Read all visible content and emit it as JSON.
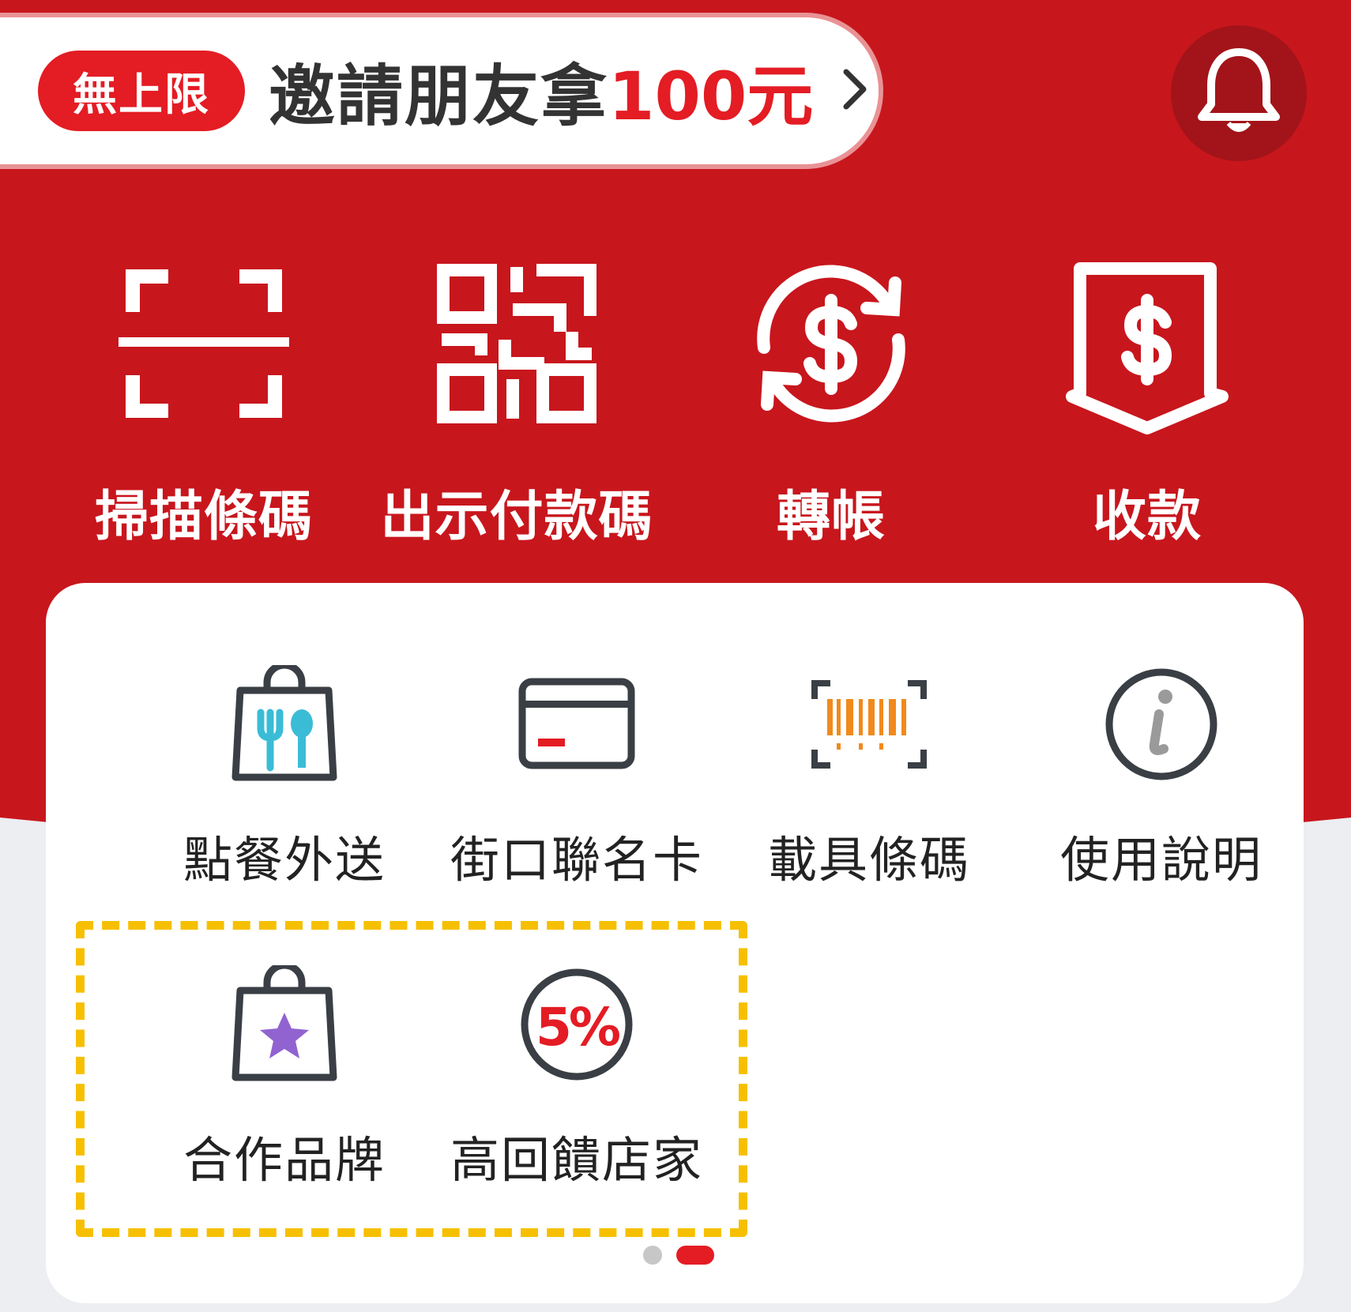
{
  "invite": {
    "badge": "無上限",
    "text": "邀請朋友拿",
    "amount": "100元"
  },
  "actions": [
    {
      "label": "掃描條碼",
      "icon": "scan-frame-icon"
    },
    {
      "label": "出示付款碼",
      "icon": "qr-code-icon"
    },
    {
      "label": "轉帳",
      "icon": "dollar-cycle-icon"
    },
    {
      "label": "收款",
      "icon": "dollar-pocket-icon"
    }
  ],
  "services": [
    {
      "label": "點餐外送",
      "icon": "food-bag-icon"
    },
    {
      "label": "街口聯名卡",
      "icon": "credit-card-icon"
    },
    {
      "label": "載具條碼",
      "icon": "barcode-icon"
    },
    {
      "label": "使用說明",
      "icon": "info-icon"
    },
    {
      "label": "合作品牌",
      "icon": "star-bag-icon"
    },
    {
      "label": "高回饋店家",
      "icon": "percent-circle-icon",
      "icon_text": "5%"
    }
  ],
  "colors": {
    "brand_red": "#c8161d",
    "accent_red": "#e41c24",
    "highlight": "#f6c000",
    "food_teal": "#3bbcd6",
    "barcode_orange": "#f08a1c",
    "star_purple": "#9163d0"
  }
}
